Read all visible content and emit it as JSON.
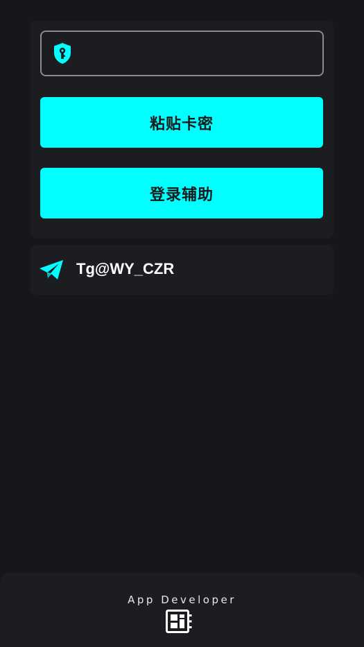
{
  "login": {
    "key_input": {
      "value": "",
      "placeholder": "",
      "icon": "shield-key-icon"
    },
    "paste_button_label": "粘贴卡密",
    "login_button_label": "登录辅助"
  },
  "contact": {
    "icon": "telegram-send-icon",
    "label": "Tg@WY_CZR"
  },
  "footer": {
    "label": "App Developer",
    "icon": "developer-board-icon"
  },
  "colors": {
    "background": "#16171a",
    "card": "#1c1d21",
    "accent": "#00ffff",
    "field_border": "#8a8c92"
  }
}
